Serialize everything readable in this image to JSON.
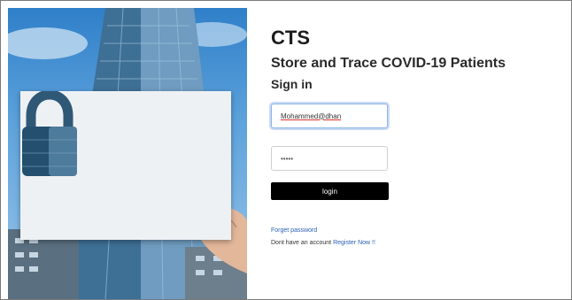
{
  "brand": {
    "title": "CTS"
  },
  "tagline": "Store and Trace COVID-19 Patients",
  "signin": {
    "heading": "Sign in"
  },
  "form": {
    "email_value": "Mohammed@dhan",
    "password_value": "•••••",
    "login_label": "login"
  },
  "links": {
    "forgot": "Forget password",
    "no_account": "Dont have an account",
    "register": "Register Now !!"
  },
  "icons": {
    "lock": "padlock-icon"
  },
  "colors": {
    "button": "#000000",
    "link": "#2b5fb8",
    "focus_border": "#8fb3e6"
  }
}
